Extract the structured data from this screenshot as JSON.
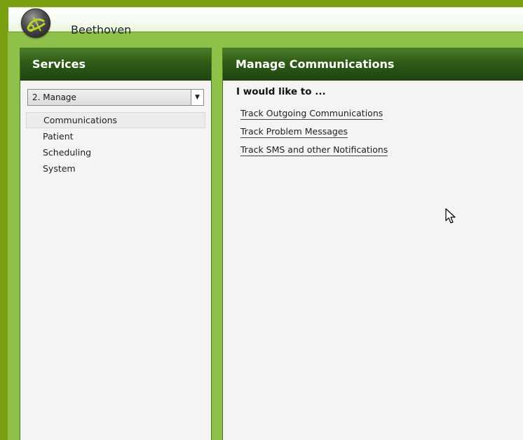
{
  "window": {
    "title": "Beethoven",
    "logo_icon": "beethoven-logo-icon"
  },
  "services": {
    "title": "Services",
    "dropdown": {
      "selected": "2. Manage",
      "arrow": "▼"
    },
    "items": [
      {
        "label": "Communications",
        "selected": true
      },
      {
        "label": "Patient",
        "selected": false
      },
      {
        "label": "Scheduling",
        "selected": false
      },
      {
        "label": "System",
        "selected": false
      }
    ]
  },
  "manage": {
    "title": "Manage Communications",
    "intro": "I would like to ...",
    "links": [
      {
        "label": "Track Outgoing Communications"
      },
      {
        "label": "Track Problem Messages"
      },
      {
        "label": "Track SMS and other Notifications"
      }
    ]
  },
  "colors": {
    "background": "#8ec04a",
    "frame": "#7aa012",
    "header_dark": "#1f4610",
    "panel_bg": "#f4f4f4"
  }
}
